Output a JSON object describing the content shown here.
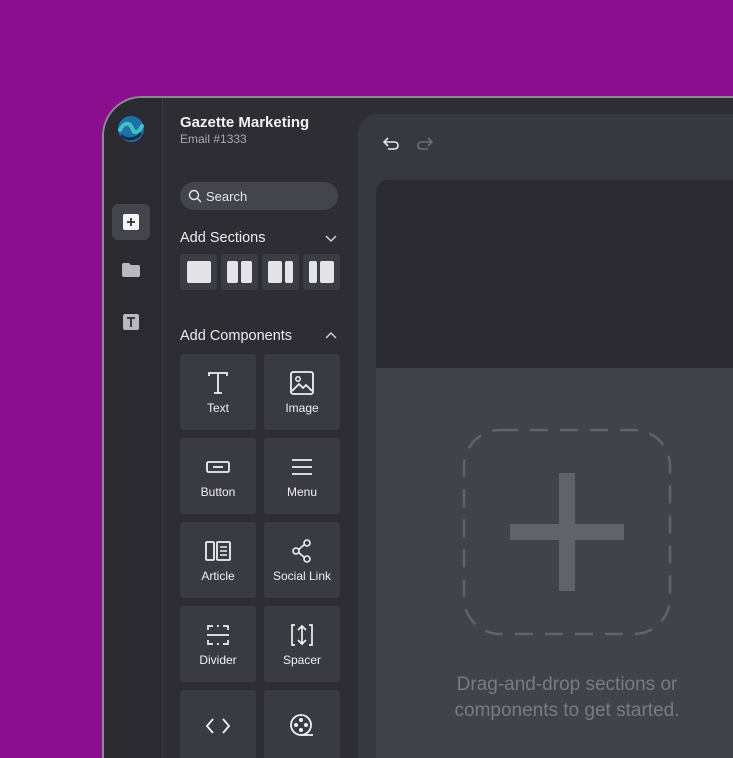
{
  "app": {
    "title": "Gazette Marketing",
    "subtitle": "Email #1333"
  },
  "rail": {
    "items": [
      {
        "icon": "plus-square-icon",
        "active": true
      },
      {
        "icon": "folder-icon",
        "active": false
      },
      {
        "icon": "text-box-icon",
        "active": false
      }
    ]
  },
  "search": {
    "placeholder": "Search"
  },
  "sections": {
    "label": "Add Sections",
    "layouts": [
      "one-column",
      "two-column",
      "wide-narrow",
      "narrow-wide"
    ]
  },
  "components": {
    "label": "Add Components",
    "items": [
      {
        "label": "Text",
        "icon": "text-icon"
      },
      {
        "label": "Image",
        "icon": "image-icon"
      },
      {
        "label": "Button",
        "icon": "button-icon"
      },
      {
        "label": "Menu",
        "icon": "menu-icon"
      },
      {
        "label": "Article",
        "icon": "article-icon"
      },
      {
        "label": "Social Link",
        "icon": "share-icon"
      },
      {
        "label": "Divider",
        "icon": "divider-icon"
      },
      {
        "label": "Spacer",
        "icon": "spacer-icon"
      },
      {
        "label": "",
        "icon": "code-icon"
      },
      {
        "label": "",
        "icon": "video-icon"
      }
    ]
  },
  "canvas": {
    "drop_line1": "Drag-and-drop sections or",
    "drop_line2": "components to get started."
  },
  "colors": {
    "background": "#8b0e8f",
    "panel": "#2d2d33",
    "canvas": "#38383f"
  }
}
